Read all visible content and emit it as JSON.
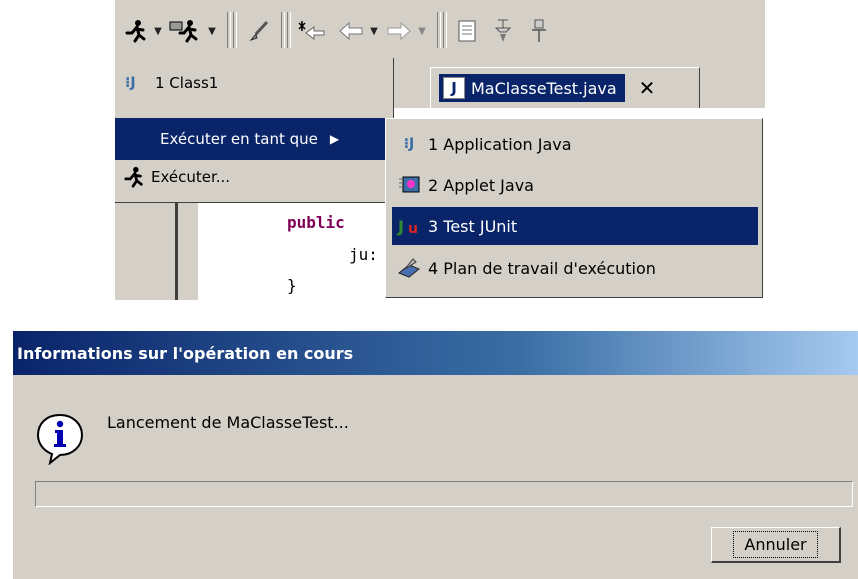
{
  "toolbar": {
    "icons": [
      "run-icon",
      "debug-icon",
      "brush-icon",
      "back-icon",
      "forward-icon",
      "page-icon",
      "pin-icon"
    ]
  },
  "menu": {
    "items": [
      {
        "label": "1 Class1",
        "icon": "java-class-icon"
      },
      {
        "label": "Exécuter en tant que",
        "icon": "none",
        "selected": true
      },
      {
        "label": "Exécuter...",
        "icon": "run-icon"
      }
    ]
  },
  "submenu": {
    "items": [
      {
        "label": "1 Application Java",
        "icon": "java-class-icon"
      },
      {
        "label": "2 Applet Java",
        "icon": "applet-icon"
      },
      {
        "label": "3 Test JUnit",
        "icon": "junit-icon",
        "selected": true
      },
      {
        "label": "4 Plan de travail d'exécution",
        "icon": "workbench-icon"
      }
    ]
  },
  "editor": {
    "tab_title": "MaClasseTest.java",
    "code_lines": [
      "public",
      "ju:",
      "}"
    ]
  },
  "dialog": {
    "title": "Informations sur l'opération en cours",
    "message": "Lancement de MaClasseTest...",
    "progress": 0,
    "cancel_label": "Annuler"
  },
  "colors": {
    "selection": "#0a246a",
    "face": "#d4d0c8",
    "keyword": "#7f0055"
  }
}
